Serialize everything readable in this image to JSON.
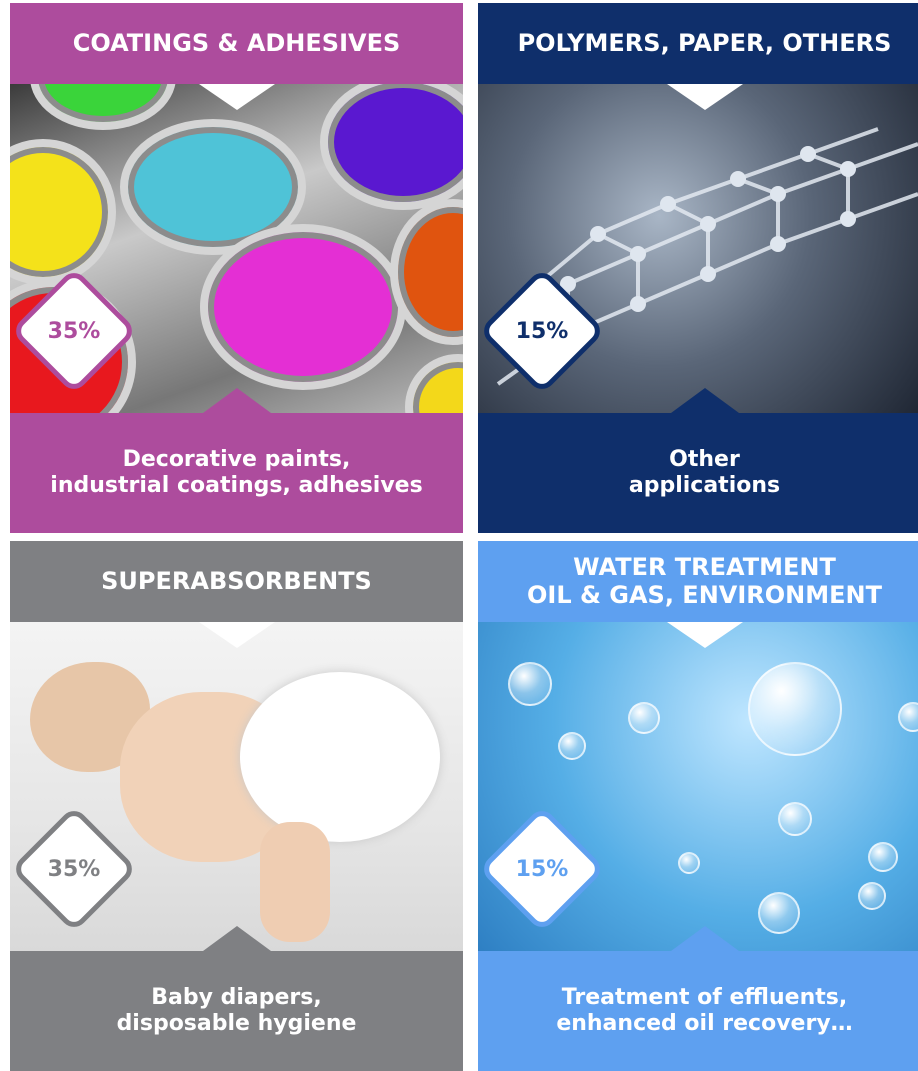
{
  "panels": [
    {
      "title": "COATINGS & ADHESIVES",
      "percent": "35%",
      "description_line1": "Decorative paints,",
      "description_line2": "industrial coatings, adhesives",
      "image": "paint-cans",
      "color": "#ad4c9d"
    },
    {
      "title": "POLYMERS, PAPER, OTHERS",
      "percent": "15%",
      "description_line1": "Other",
      "description_line2": "applications",
      "image": "molecular-nanotube",
      "color": "#0f2f6b"
    },
    {
      "title": "SUPERABSORBENTS",
      "percent": "35%",
      "description_line1": "Baby diapers,",
      "description_line2": "disposable hygiene",
      "image": "baby-in-diaper",
      "color": "#7f8083"
    },
    {
      "title_line1": "WATER TREATMENT",
      "title_line2": "OIL & GAS, ENVIRONMENT",
      "percent": "15%",
      "description_line1": "Treatment of effluents,",
      "description_line2": "enhanced oil recovery…",
      "image": "water-bubbles",
      "color": "#5ea0f0"
    }
  ]
}
